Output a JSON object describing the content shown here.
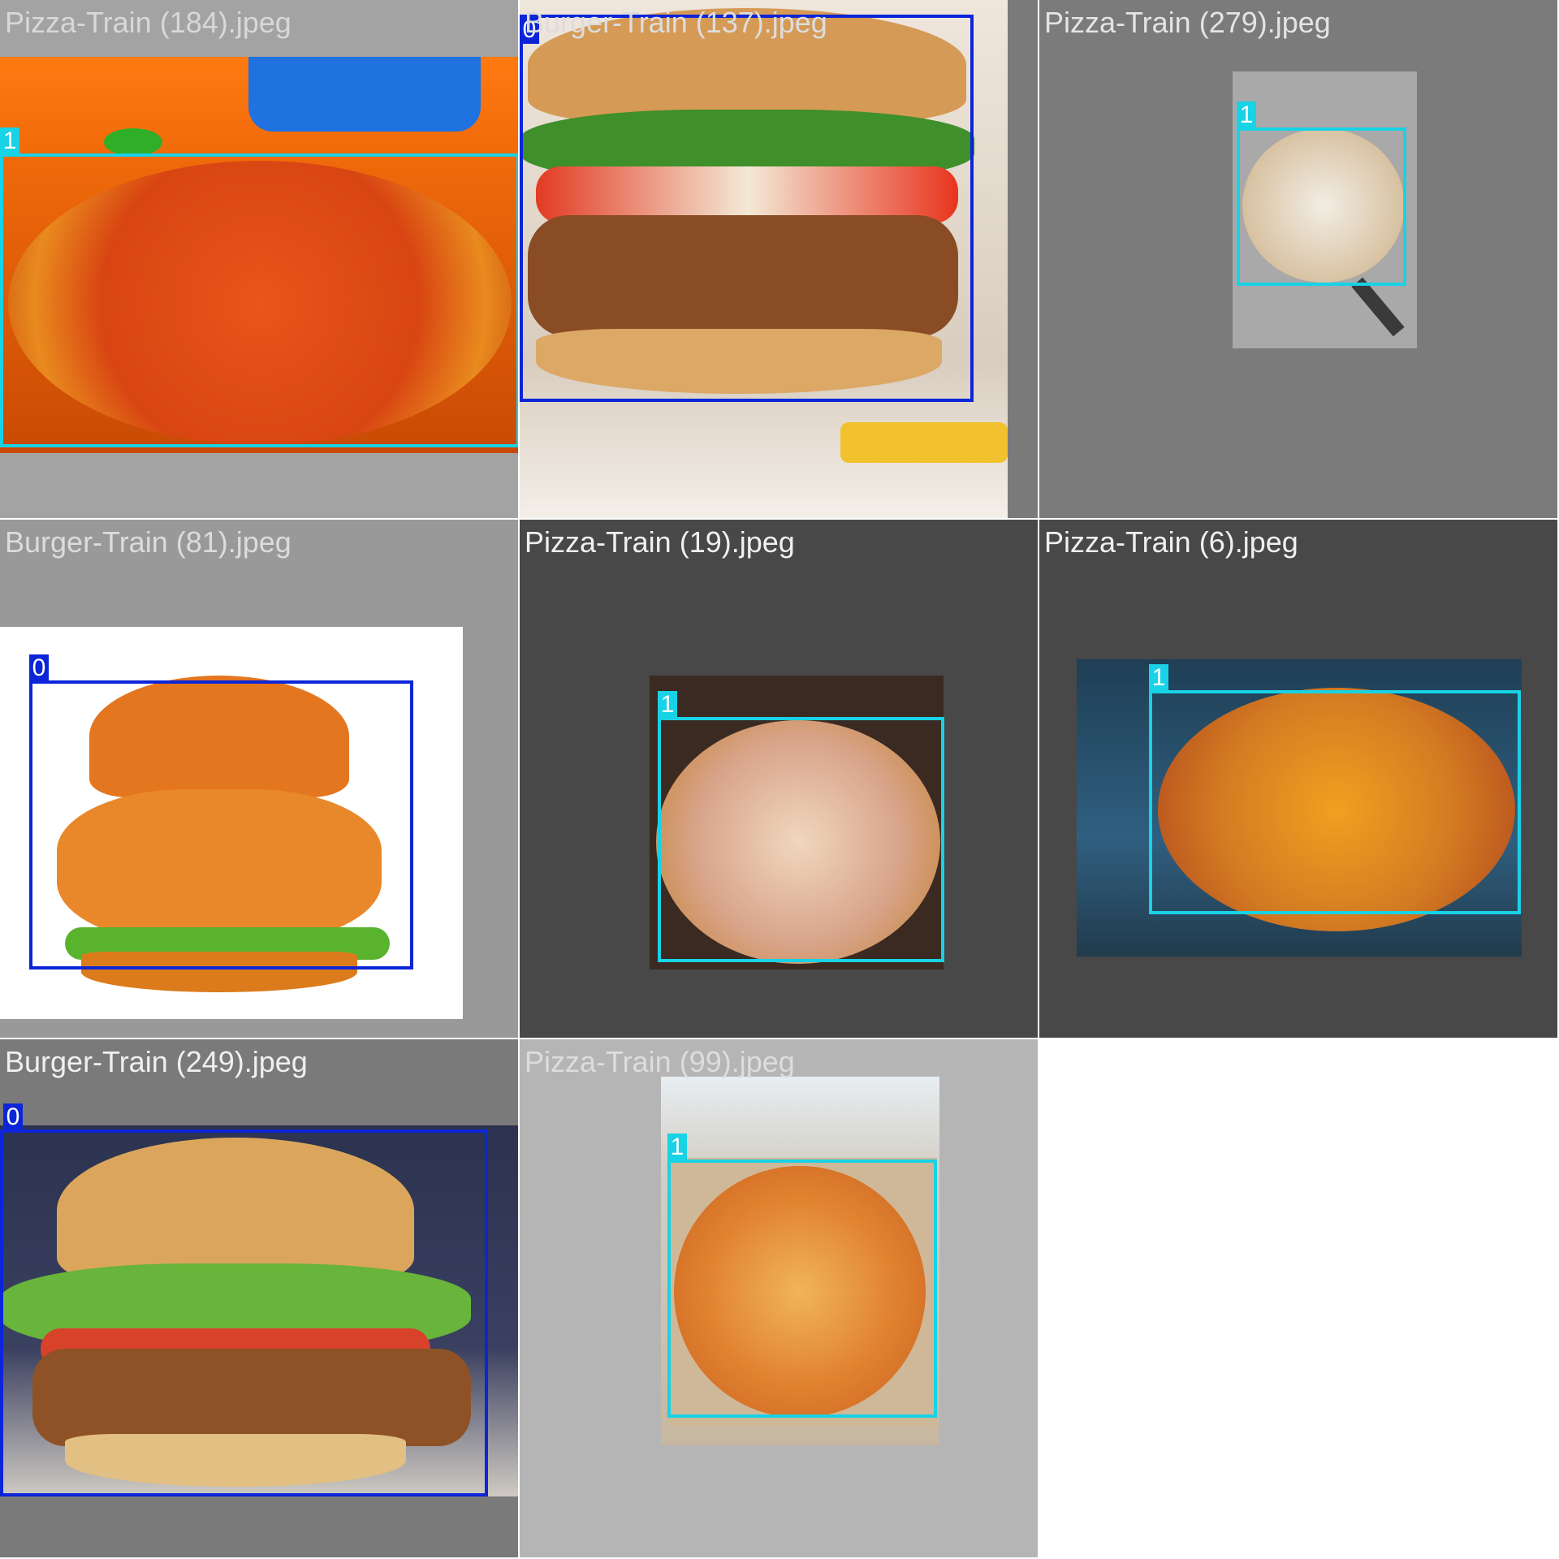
{
  "mosaic": {
    "tiles": [
      {
        "filename": "Pizza-Train (184).jpeg",
        "label": "1"
      },
      {
        "filename": "Burger-Train (137).jpeg",
        "label": "0"
      },
      {
        "filename": "Pizza-Train (279).jpeg",
        "label": "1"
      },
      {
        "filename": "Burger-Train (81).jpeg",
        "label": "0"
      },
      {
        "filename": "Pizza-Train (19).jpeg",
        "label": "1"
      },
      {
        "filename": "Pizza-Train (6).jpeg",
        "label": "1"
      },
      {
        "filename": "Burger-Train (249).jpeg",
        "label": "0"
      },
      {
        "filename": "Pizza-Train (99).jpeg",
        "label": "1"
      }
    ]
  },
  "colors": {
    "class_0": "#0c25d8",
    "class_1": "#18d2e6"
  }
}
